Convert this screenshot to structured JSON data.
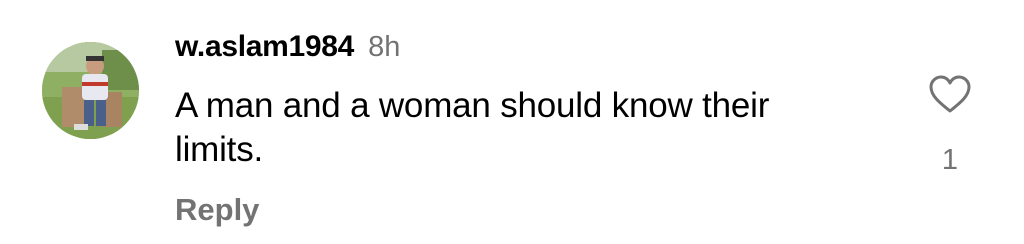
{
  "comment": {
    "username": "w.aslam1984",
    "timestamp": "8h",
    "text": "A man and a woman should know their limits.",
    "reply_label": "Reply",
    "like_count": "1",
    "avatar_icon": "user-avatar-photo",
    "like_icon": "heart-outline-icon"
  },
  "colors": {
    "primary_text": "#000000",
    "secondary_text": "#737373",
    "background": "#ffffff"
  }
}
